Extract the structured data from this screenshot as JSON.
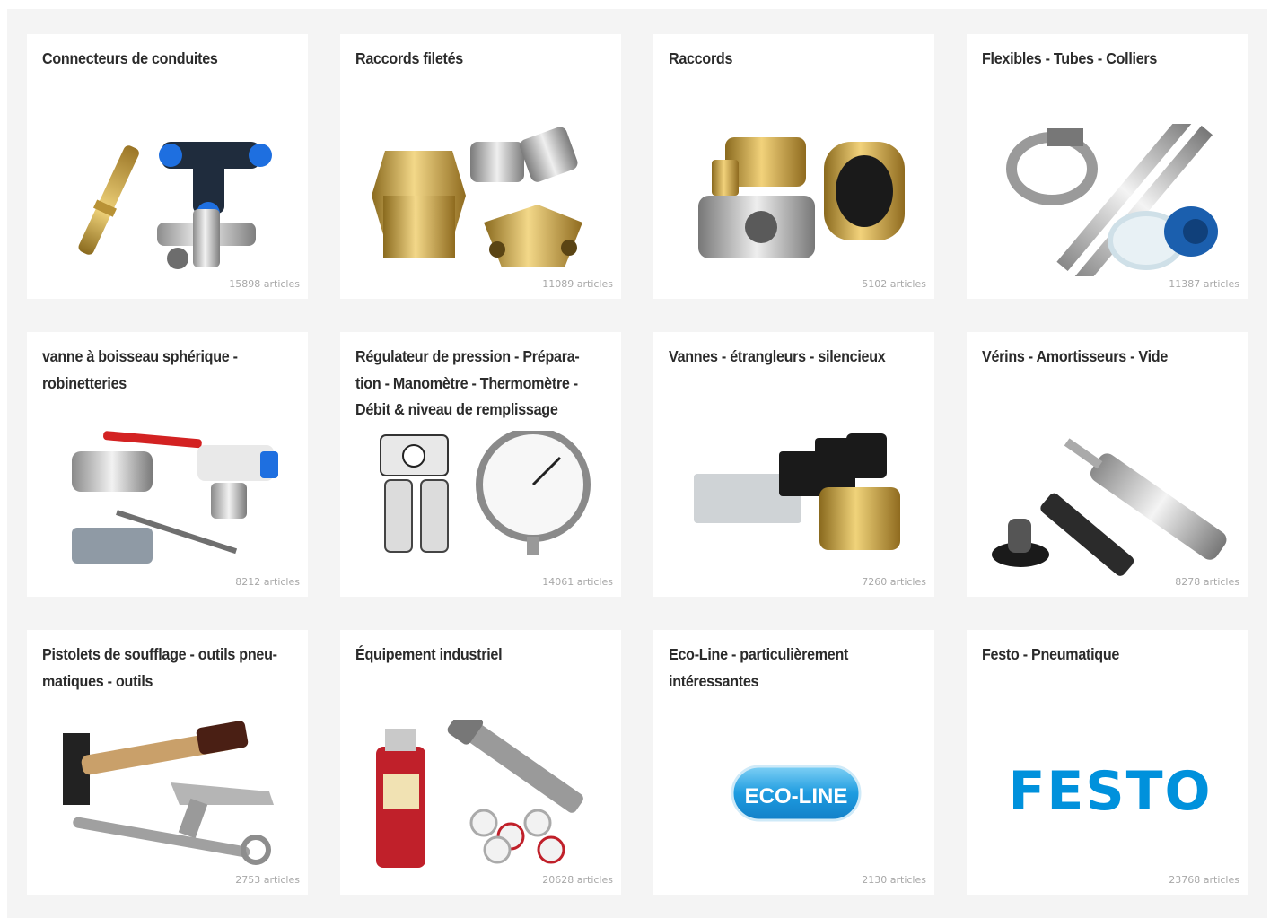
{
  "categories": [
    {
      "title": "Connecteurs de conduites",
      "count": "15898",
      "unit": "articles",
      "icon": "pipe-connectors-image"
    },
    {
      "title": "Raccords filetés",
      "count": "11089",
      "unit": "articles",
      "icon": "threaded-fittings-image"
    },
    {
      "title": "Raccords",
      "count": "5102",
      "unit": "articles",
      "icon": "couplings-image"
    },
    {
      "title": "Flexibles - Tubes - Colliers",
      "count": "11387",
      "unit": "articles",
      "icon": "hoses-tubes-clamps-image"
    },
    {
      "title": "vanne à boisseau sphérique - robinetteries",
      "count": "8212",
      "unit": "articles",
      "icon": "ball-valve-image"
    },
    {
      "title": "Régulateur de pression - Prépara-tion - Manomètre - Thermomètre - Débit & niveau de remplissage",
      "count": "14061",
      "unit": "articles",
      "icon": "pressure-regulator-gauge-image"
    },
    {
      "title": "Vannes - étrangleurs - silencieux",
      "count": "7260",
      "unit": "articles",
      "icon": "solenoid-valves-image"
    },
    {
      "title": "Vérins - Amortisseurs - Vide",
      "count": "8278",
      "unit": "articles",
      "icon": "cylinders-dampers-vacuum-image"
    },
    {
      "title": "Pistolets de soufflage - outils pneu-matiques - outils",
      "count": "2753",
      "unit": "articles",
      "icon": "blow-gun-tools-image"
    },
    {
      "title": "Équipement industriel",
      "count": "20628",
      "unit": "articles",
      "icon": "industrial-equipment-image"
    },
    {
      "title": "Eco-Line - particulièrement intéressantes",
      "count": "2130",
      "unit": "articles",
      "icon": "eco-line-logo",
      "logo_text": "ECO-LINE"
    },
    {
      "title": "Festo - Pneumatique",
      "count": "23768",
      "unit": "articles",
      "icon": "festo-logo",
      "logo_text": "FESTO"
    }
  ],
  "colors": {
    "festo_blue": "#0091dc",
    "ecoline_blue": "#1e9ce0",
    "panel_bg": "#f4f4f4",
    "title_text": "#2b2b2b",
    "count_text": "#a8a8a8"
  }
}
